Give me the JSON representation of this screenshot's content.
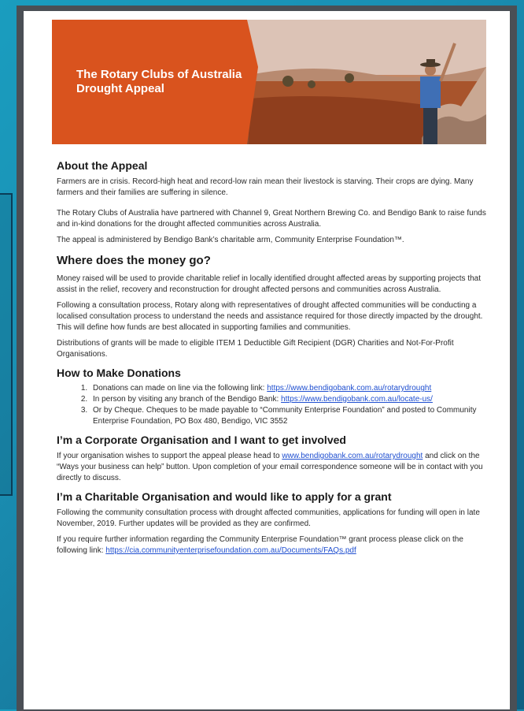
{
  "banner": {
    "title": "The Rotary Clubs of Australia Drought Appeal",
    "accent_color": "#d9531e"
  },
  "about": {
    "heading": "About the Appeal",
    "p1": "Farmers are in crisis. Record-high heat and record-low rain mean their livestock is starving. Their crops are dying. Many farmers and their families are suffering in silence.",
    "p2": "The Rotary Clubs of Australia have partnered with Channel 9, Great Northern Brewing Co. and Bendigo Bank to raise funds and in-kind donations for the drought affected communities across Australia.",
    "p3": "The appeal is administered by Bendigo Bank’s charitable arm, Community Enterprise Foundation™."
  },
  "money": {
    "heading": "Where does the money go?",
    "p1": "Money raised will be used to provide charitable relief in locally identified drought affected areas by supporting projects that assist in the relief, recovery and reconstruction for drought affected persons and communities across Australia.",
    "p2": "Following a consultation process, Rotary along with representatives of drought affected communities will be conducting a localised consultation process to understand the needs and assistance required for those directly impacted by the drought. This will define how funds are best allocated in supporting families and communities.",
    "p3": "Distributions of grants will be made to eligible ITEM 1 Deductible Gift Recipient (DGR) Charities and Not-For-Profit Organisations."
  },
  "donations": {
    "heading": "How to Make Donations",
    "item1_text": "Donations can made on line via the following link: ",
    "item1_link": "https://www.bendigobank.com.au/rotarydrought",
    "item2_text": "In person by visiting any branch of the Bendigo Bank: ",
    "item2_link": "https://www.bendigobank.com.au/locate-us/",
    "item3_text": "Or by Cheque. Cheques to be made payable to “Community Enterprise Foundation” and posted to Community Enterprise Foundation, PO Box 480, Bendigo, VIC 3552"
  },
  "corporate": {
    "heading": "I’m a Corporate Organisation and I want to get involved",
    "text_before": "If your organisation wishes to support the appeal please head to  ",
    "link": "www.bendigobank.com.au/rotarydrought",
    "text_after": " and click on the “Ways your business can help” button. Upon completion of your email correspondence someone will be in contact with you directly to discuss."
  },
  "charitable": {
    "heading": "I’m a Charitable Organisation and would like to apply for a grant",
    "p1": "Following the community consultation process with drought affected communities, applications for funding will open in late November, 2019. Further updates will be provided as they are confirmed.",
    "p2_text": "If you require further information regarding the Community Enterprise Foundation™ grant process please click on the following link: ",
    "p2_link": "https://cia.communityenterprisefoundation.com.au/Documents/FAQs.pdf"
  }
}
